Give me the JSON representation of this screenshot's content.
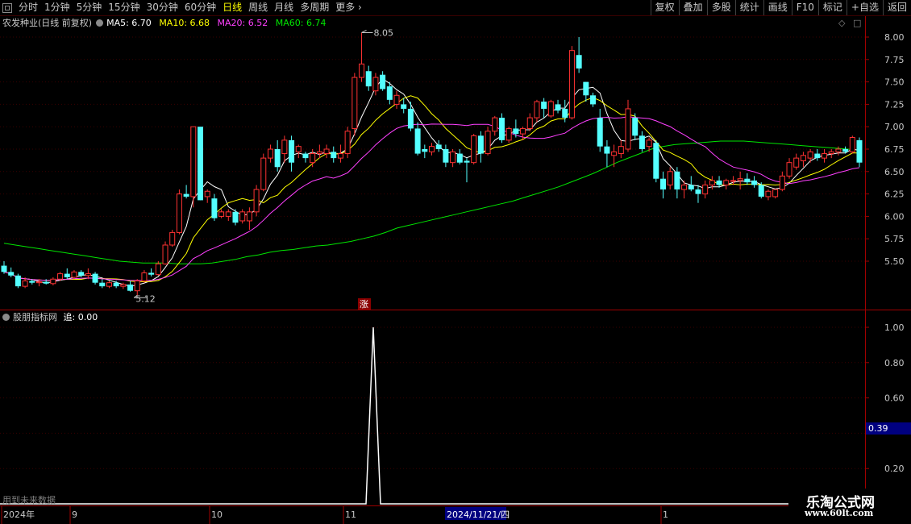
{
  "toolbar": {
    "periods": [
      "分时",
      "1分钟",
      "5分钟",
      "15分钟",
      "30分钟",
      "60分钟",
      "日线",
      "周线",
      "月线",
      "多周期",
      "更多"
    ],
    "active_period": "日线",
    "right_buttons": [
      "复权",
      "叠加",
      "多股",
      "统计",
      "画线",
      "F10",
      "标记",
      "+自选",
      "返回"
    ]
  },
  "info": {
    "stock": "农发种业(日线 前复权)",
    "ma5": "MA5: 6.70",
    "ma10": "MA10: 6.68",
    "ma20": "MA20: 6.52",
    "ma60": "MA60: 6.74"
  },
  "indicator": {
    "title": "股朋指标网",
    "value": "追: 0.00",
    "current_value": "0.39"
  },
  "price_axis": [
    "8.00",
    "7.75",
    "7.50",
    "7.25",
    "7.00",
    "6.75",
    "6.50",
    "6.25",
    "6.00",
    "5.75",
    "5.50"
  ],
  "ind_axis": [
    "1.00",
    "0.80",
    "0.60",
    "0.20"
  ],
  "date_axis": {
    "year": "2024年",
    "m9": "9",
    "m10": "10",
    "m11": "11",
    "m1": "1",
    "cursor": "2024/11/21/四"
  },
  "annotations": {
    "high": "8.05",
    "low": "5.12",
    "limit": "涨",
    "future_note": "用到未来数据"
  },
  "watermark": {
    "line1": "乐淘公式网",
    "line2": "www.60lt.com"
  },
  "colors": {
    "up": "#ff3232",
    "down": "#54ffff",
    "ma5": "#ffffff",
    "ma10": "#ffff00",
    "ma20": "#ff40ff",
    "ma60": "#00e600",
    "axis": "#a00000"
  },
  "chart_data": {
    "type": "candlestick",
    "y_range": [
      5.12,
      8.05
    ],
    "candles": [
      [
        5.45,
        5.5,
        5.36,
        5.38
      ],
      [
        5.38,
        5.43,
        5.32,
        5.34
      ],
      [
        5.34,
        5.36,
        5.2,
        5.22
      ],
      [
        5.22,
        5.32,
        5.2,
        5.28
      ],
      [
        5.28,
        5.3,
        5.24,
        5.26
      ],
      [
        5.26,
        5.3,
        5.22,
        5.27
      ],
      [
        5.27,
        5.3,
        5.24,
        5.25
      ],
      [
        5.25,
        5.32,
        5.23,
        5.3
      ],
      [
        5.3,
        5.38,
        5.28,
        5.36
      ],
      [
        5.36,
        5.42,
        5.3,
        5.32
      ],
      [
        5.32,
        5.4,
        5.3,
        5.38
      ],
      [
        5.38,
        5.4,
        5.32,
        5.34
      ],
      [
        5.34,
        5.42,
        5.3,
        5.36
      ],
      [
        5.36,
        5.38,
        5.24,
        5.26
      ],
      [
        5.26,
        5.3,
        5.2,
        5.22
      ],
      [
        5.22,
        5.28,
        5.2,
        5.26
      ],
      [
        5.26,
        5.28,
        5.2,
        5.22
      ],
      [
        5.22,
        5.26,
        5.19,
        5.24
      ],
      [
        5.24,
        5.28,
        5.16,
        5.17
      ],
      [
        5.17,
        5.3,
        5.12,
        5.28
      ],
      [
        5.28,
        5.4,
        5.26,
        5.37
      ],
      [
        5.37,
        5.42,
        5.33,
        5.35
      ],
      [
        5.35,
        5.5,
        5.34,
        5.47
      ],
      [
        5.47,
        5.72,
        5.46,
        5.68
      ],
      [
        5.68,
        5.85,
        5.66,
        5.82
      ],
      [
        5.82,
        6.3,
        5.8,
        6.25
      ],
      [
        6.25,
        6.35,
        6.2,
        6.22
      ],
      [
        6.22,
        7.0,
        6.1,
        7.0
      ],
      [
        7.0,
        6.85,
        6.18,
        6.18
      ],
      [
        6.22,
        6.3,
        6.15,
        6.28
      ],
      [
        6.2,
        6.25,
        5.95,
        5.98
      ],
      [
        6.0,
        6.08,
        5.98,
        6.05
      ],
      [
        6.0,
        6.08,
        5.95,
        6.05
      ],
      [
        6.05,
        6.08,
        5.9,
        5.93
      ],
      [
        5.95,
        6.08,
        5.92,
        6.05
      ],
      [
        5.95,
        6.1,
        5.85,
        6.05
      ],
      [
        6.05,
        6.35,
        6.0,
        6.3
      ],
      [
        6.3,
        6.7,
        6.28,
        6.65
      ],
      [
        6.65,
        6.8,
        6.6,
        6.75
      ],
      [
        6.75,
        6.85,
        6.5,
        6.55
      ],
      [
        6.7,
        6.9,
        6.6,
        6.85
      ],
      [
        6.85,
        6.9,
        6.5,
        6.6
      ],
      [
        6.72,
        6.8,
        6.65,
        6.78
      ],
      [
        6.7,
        6.72,
        6.6,
        6.65
      ],
      [
        6.6,
        6.75,
        6.55,
        6.7
      ],
      [
        6.7,
        6.8,
        6.65,
        6.72
      ],
      [
        6.7,
        6.8,
        6.65,
        6.75
      ],
      [
        6.72,
        6.78,
        6.6,
        6.65
      ],
      [
        6.65,
        6.8,
        6.6,
        6.7
      ],
      [
        6.7,
        7.0,
        6.65,
        6.95
      ],
      [
        6.98,
        7.6,
        6.9,
        7.55
      ],
      [
        7.55,
        8.05,
        7.5,
        7.7
      ],
      [
        7.62,
        7.68,
        7.4,
        7.45
      ],
      [
        7.4,
        7.6,
        7.35,
        7.55
      ],
      [
        7.58,
        7.62,
        7.4,
        7.42
      ],
      [
        7.45,
        7.5,
        7.25,
        7.3
      ],
      [
        7.25,
        7.4,
        7.2,
        7.35
      ],
      [
        7.25,
        7.32,
        7.15,
        7.2
      ],
      [
        7.2,
        7.28,
        6.95,
        6.98
      ],
      [
        6.98,
        7.05,
        6.68,
        6.7
      ],
      [
        6.75,
        6.8,
        6.65,
        6.72
      ],
      [
        6.72,
        6.82,
        6.68,
        6.78
      ],
      [
        6.8,
        6.85,
        6.72,
        6.75
      ],
      [
        6.75,
        6.8,
        6.55,
        6.6
      ],
      [
        6.6,
        6.75,
        6.55,
        6.72
      ],
      [
        6.7,
        6.75,
        6.58,
        6.6
      ],
      [
        6.62,
        6.65,
        6.38,
        6.6
      ],
      [
        6.6,
        6.92,
        6.58,
        6.9
      ],
      [
        6.9,
        6.95,
        6.6,
        6.7
      ],
      [
        6.7,
        7.0,
        6.68,
        6.95
      ],
      [
        6.95,
        7.12,
        6.9,
        7.1
      ],
      [
        7.1,
        7.15,
        6.82,
        6.85
      ],
      [
        6.85,
        7.0,
        6.82,
        6.98
      ],
      [
        6.98,
        7.08,
        6.88,
        6.92
      ],
      [
        6.92,
        7.0,
        6.85,
        6.98
      ],
      [
        6.98,
        7.15,
        6.95,
        7.1
      ],
      [
        7.1,
        7.3,
        7.05,
        7.28
      ],
      [
        7.28,
        7.32,
        7.1,
        7.2
      ],
      [
        7.12,
        7.3,
        7.1,
        7.28
      ],
      [
        7.25,
        7.3,
        7.15,
        7.18
      ],
      [
        7.2,
        7.3,
        7.05,
        7.1
      ],
      [
        7.1,
        7.9,
        7.08,
        7.85
      ],
      [
        7.8,
        8.0,
        7.6,
        7.65
      ],
      [
        7.5,
        7.5,
        7.28,
        7.35
      ],
      [
        7.35,
        7.38,
        7.22,
        7.25
      ],
      [
        7.1,
        7.2,
        6.72,
        6.78
      ],
      [
        6.78,
        6.85,
        6.55,
        6.7
      ],
      [
        6.68,
        6.8,
        6.55,
        6.72
      ],
      [
        6.7,
        6.85,
        6.65,
        6.78
      ],
      [
        6.75,
        7.3,
        6.72,
        7.2
      ],
      [
        7.1,
        7.15,
        6.85,
        6.9
      ],
      [
        6.9,
        6.95,
        6.72,
        6.75
      ],
      [
        6.78,
        6.88,
        6.72,
        6.85
      ],
      [
        6.82,
        6.85,
        6.38,
        6.42
      ],
      [
        6.42,
        6.5,
        6.2,
        6.3
      ],
      [
        6.35,
        6.55,
        6.3,
        6.5
      ],
      [
        6.5,
        6.55,
        6.2,
        6.3
      ],
      [
        6.3,
        6.4,
        6.2,
        6.35
      ],
      [
        6.35,
        6.45,
        6.28,
        6.3
      ],
      [
        6.3,
        6.35,
        6.15,
        6.25
      ],
      [
        6.25,
        6.4,
        6.2,
        6.35
      ],
      [
        6.35,
        6.45,
        6.3,
        6.4
      ],
      [
        6.4,
        6.45,
        6.32,
        6.35
      ],
      [
        6.35,
        6.42,
        6.3,
        6.4
      ],
      [
        6.4,
        6.45,
        6.35,
        6.4
      ],
      [
        6.4,
        6.5,
        6.3,
        6.42
      ],
      [
        6.42,
        6.48,
        6.35,
        6.38
      ],
      [
        6.4,
        6.45,
        6.32,
        6.35
      ],
      [
        6.35,
        6.38,
        6.2,
        6.22
      ],
      [
        6.22,
        6.3,
        6.18,
        6.28
      ],
      [
        6.22,
        6.3,
        6.2,
        6.3
      ],
      [
        6.3,
        6.5,
        6.28,
        6.45
      ],
      [
        6.45,
        6.65,
        6.42,
        6.6
      ],
      [
        6.55,
        6.7,
        6.52,
        6.65
      ],
      [
        6.62,
        6.72,
        6.55,
        6.68
      ],
      [
        6.65,
        6.75,
        6.6,
        6.72
      ],
      [
        6.7,
        6.75,
        6.62,
        6.65
      ],
      [
        6.65,
        6.75,
        6.6,
        6.7
      ],
      [
        6.7,
        6.75,
        6.65,
        6.72
      ],
      [
        6.72,
        6.78,
        6.68,
        6.75
      ],
      [
        6.75,
        6.78,
        6.7,
        6.72
      ],
      [
        6.72,
        6.9,
        6.7,
        6.88
      ],
      [
        6.85,
        6.88,
        6.55,
        6.6
      ]
    ],
    "ma60": [
      5.7,
      5.68,
      5.66,
      5.64,
      5.62,
      5.6,
      5.58,
      5.56,
      5.54,
      5.52,
      5.5,
      5.49,
      5.48,
      5.48,
      5.48,
      5.47,
      5.47,
      5.47,
      5.48,
      5.5,
      5.52,
      5.55,
      5.57,
      5.6,
      5.62,
      5.63,
      5.65,
      5.67,
      5.68,
      5.7,
      5.72,
      5.75,
      5.78,
      5.82,
      5.87,
      5.9,
      5.93,
      5.96,
      5.99,
      6.02,
      6.05,
      6.08,
      6.11,
      6.14,
      6.17,
      6.21,
      6.25,
      6.29,
      6.33,
      6.38,
      6.43,
      6.48,
      6.54,
      6.6,
      6.65,
      6.7,
      6.75,
      6.78,
      6.8,
      6.81,
      6.82,
      6.83,
      6.84,
      6.84,
      6.84,
      6.83,
      6.82,
      6.81,
      6.8,
      6.79,
      6.78,
      6.77,
      6.76,
      6.75,
      6.74
    ],
    "indicator": {
      "spike_x": 463,
      "peak": 1.0,
      "baseline": 0.0
    }
  }
}
